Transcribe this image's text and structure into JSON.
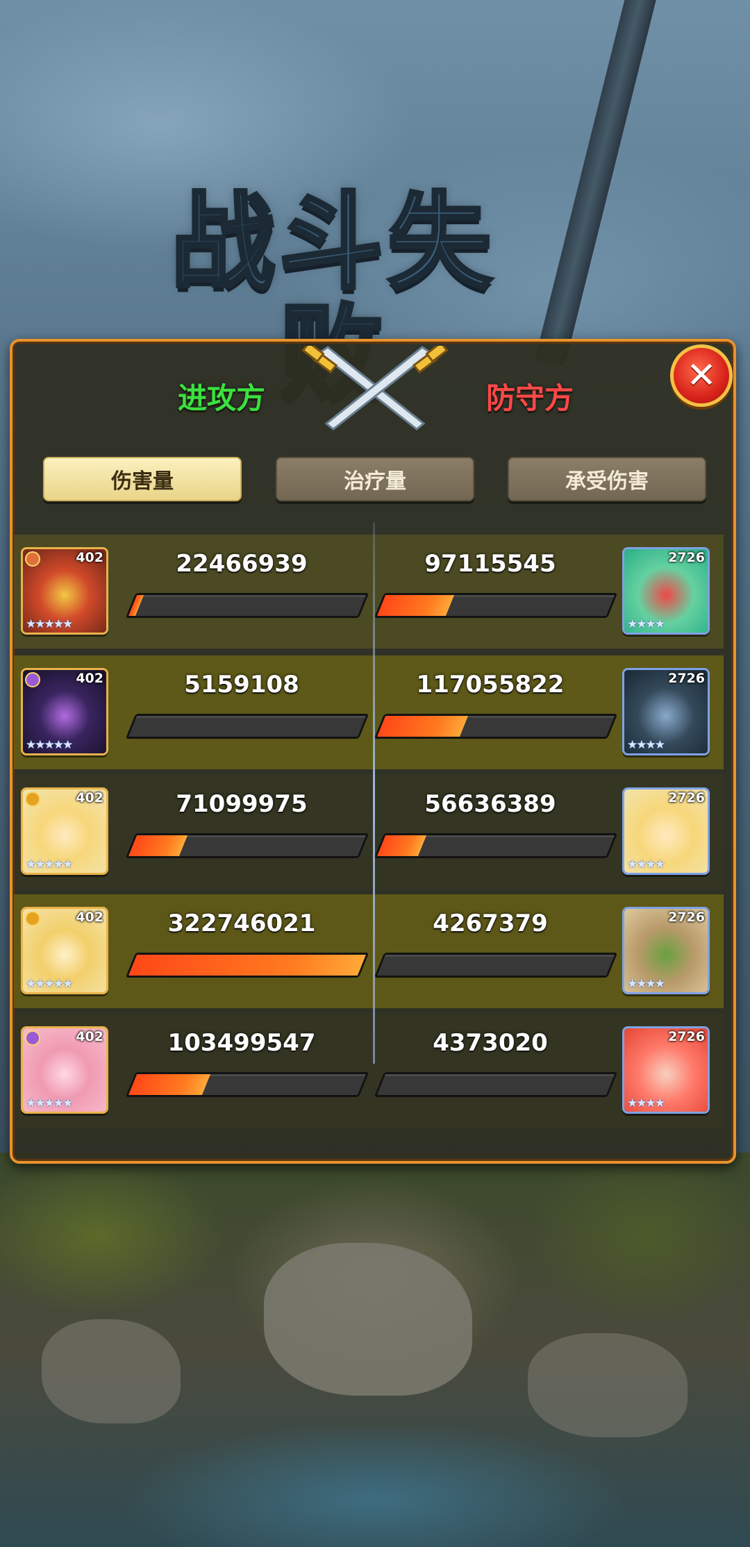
{
  "title": "战斗失败",
  "panel": {
    "attacker_label": "进攻方",
    "defender_label": "防守方",
    "close": "✕",
    "tabs": [
      {
        "label": "伤害量",
        "active": true
      },
      {
        "label": "治疗量",
        "active": false
      },
      {
        "label": "承受伤害",
        "active": false
      }
    ]
  },
  "rows": [
    {
      "attacker": {
        "level": "402",
        "stars": "★★★★★",
        "badge_color": "#e0703a",
        "value": "22466939",
        "fill": 0.03
      },
      "defender": {
        "level": "2726",
        "stars": "★★★★",
        "value": "97115545",
        "fill": 0.3
      }
    },
    {
      "attacker": {
        "level": "402",
        "stars": "★★★★★",
        "badge_color": "#9a5ad8",
        "value": "5159108",
        "fill": 0.0
      },
      "defender": {
        "level": "2726",
        "stars": "★★★★",
        "value": "117055822",
        "fill": 0.36
      }
    },
    {
      "attacker": {
        "level": "402",
        "stars": "★★★★★",
        "badge_color": "#e6a21e",
        "value": "71099975",
        "fill": 0.22
      },
      "defender": {
        "level": "2726",
        "stars": "★★★★",
        "value": "56636389",
        "fill": 0.18
      }
    },
    {
      "attacker": {
        "level": "402",
        "stars": "★★★★★",
        "badge_color": "#e6a21e",
        "value": "322746021",
        "fill": 1.0
      },
      "defender": {
        "level": "2726",
        "stars": "★★★★",
        "value": "4267379",
        "fill": 0.0
      }
    },
    {
      "attacker": {
        "level": "402",
        "stars": "★★★★★",
        "badge_color": "#9a5ad8",
        "value": "103499547",
        "fill": 0.32
      },
      "defender": {
        "level": "2726",
        "stars": "★★★★",
        "value": "4373020",
        "fill": 0.0
      }
    }
  ],
  "colors": {
    "attacker": "#3be13f",
    "defender": "#ff4848",
    "bar_fill": "#ff6a1c",
    "panel_border": "#e8932c"
  },
  "icons": {
    "close": "close-icon",
    "swords": "crossed-swords-icon"
  }
}
